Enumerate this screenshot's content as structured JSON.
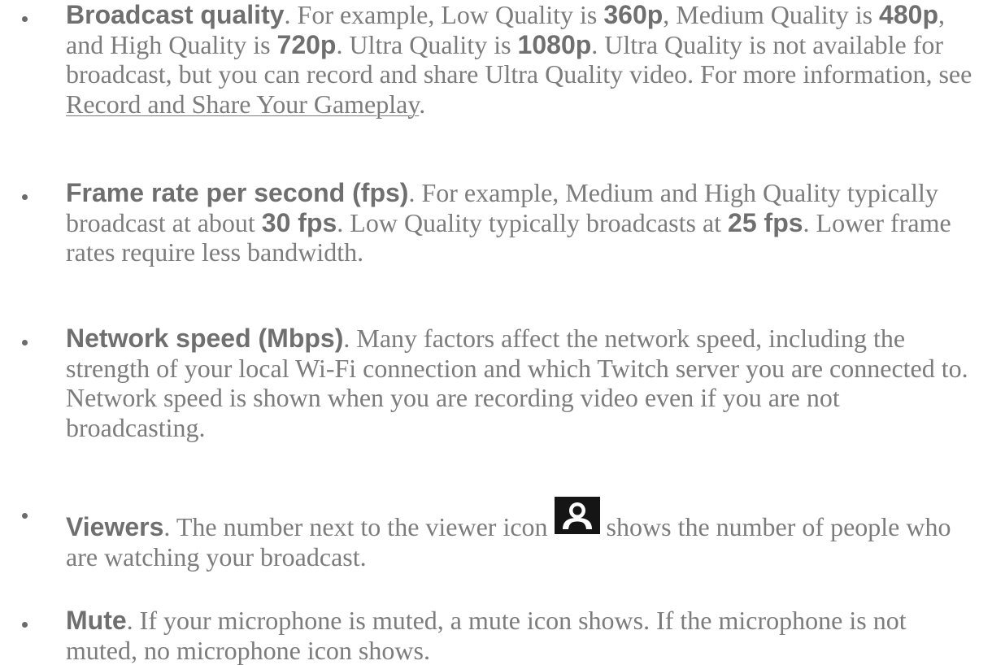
{
  "items": [
    {
      "term": "Broadcast quality",
      "t1": ". For example, Low Quality is ",
      "b1": "360p",
      "t2": ", Medium Quality is ",
      "b2": "480p",
      "t3": ", and High Quality is ",
      "b3": "720p",
      "t4": ". Ultra Quality is ",
      "b4": "1080p",
      "t5": ". Ultra Quality is not available for broadcast, but you can record and share Ultra Quality video. For more information, see ",
      "link": "Record and Share Your Gameplay",
      "t6": "."
    },
    {
      "term": "Frame rate per second (fps)",
      "t1": ". For example, Medium and High Quality typically broadcast at about ",
      "b1": "30 fps",
      "t2": ". Low Quality typically broadcasts at ",
      "b2": "25 fps",
      "t3": ". Lower frame rates require less bandwidth."
    },
    {
      "term": "Network speed (Mbps)",
      "t1": ". Many factors affect the network speed, including the strength of your local Wi-Fi connection and which Twitch server you are connected to. Network speed is shown when you are recording video even if you are not broadcasting."
    },
    {
      "term": "Viewers",
      "t1": ". The number next to the viewer icon",
      "icon": "viewer-icon",
      "t2": "shows the number of people who are watching your broadcast."
    },
    {
      "term": "Mute",
      "t1": ". If your microphone is muted, a mute icon shows. If the microphone is not muted, no microphone icon shows."
    }
  ],
  "colors": {
    "text": "#7c7c7c",
    "term": "#6f6f6f",
    "icon_bg": "#151515",
    "icon_fg": "#ffffff"
  }
}
